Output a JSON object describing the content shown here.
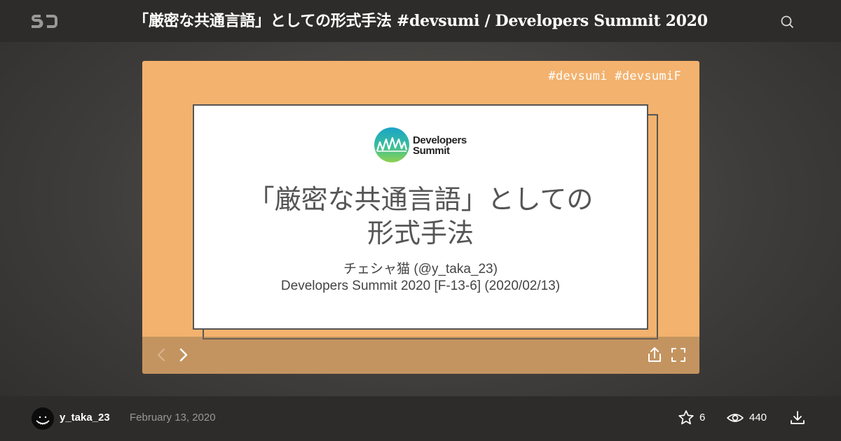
{
  "header": {
    "logo_icon": "speakerdeck-logo",
    "title": "「厳密な共通言語」としての形式手法 #devsumi / Developers Summit 2020",
    "search_icon": "search-icon"
  },
  "slide": {
    "hashtags": "#devsumi #devsumiF",
    "event_logo_line1": "Developers",
    "event_logo_line2": "Summit",
    "title_line1": "「厳密な共通言語」としての",
    "title_line2": "形式手法",
    "subtitle_line1": "チェシャ猫 (@y_taka_23)",
    "subtitle_line2": "Developers Summit 2020 [F-13-6] (2020/02/13)",
    "background_color": "#f3b26e"
  },
  "controls": {
    "prev_icon": "chevron-left-icon",
    "next_icon": "chevron-right-icon",
    "share_icon": "share-icon",
    "fullscreen_icon": "fullscreen-icon"
  },
  "footer": {
    "username": "y_taka_23",
    "date": "February 13, 2020",
    "stars": "6",
    "views": "440",
    "star_icon": "star-icon",
    "views_icon": "eye-icon",
    "download_icon": "download-icon"
  }
}
